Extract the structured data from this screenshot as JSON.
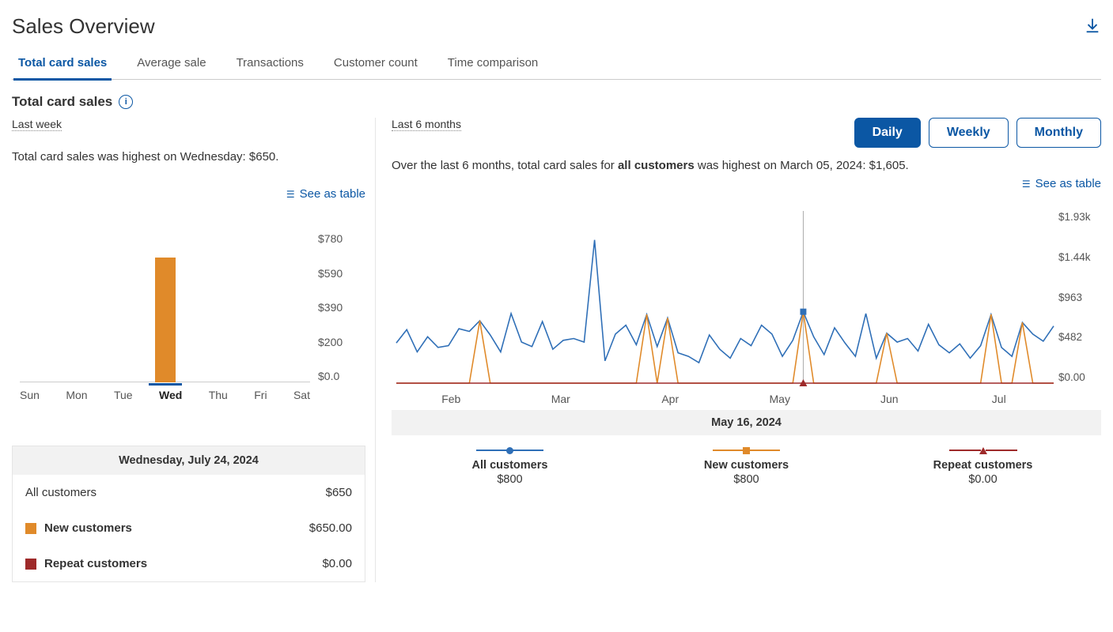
{
  "header": {
    "title": "Sales Overview"
  },
  "tabs": [
    "Total card sales",
    "Average sale",
    "Transactions",
    "Customer count",
    "Time comparison"
  ],
  "active_tab": 0,
  "section_title": "Total card sales",
  "left": {
    "period_label": "Last week",
    "sentence": "Total card sales was highest on Wednesday: $650.",
    "see_table": "See as table",
    "detail": {
      "heading": "Wednesday, July 24, 2024",
      "rows": [
        {
          "label": "All customers",
          "value": "$650"
        },
        {
          "label": "New customers",
          "value": "$650.00"
        },
        {
          "label": "Repeat customers",
          "value": "$0.00"
        }
      ]
    }
  },
  "right": {
    "period_label": "Last 6 months",
    "toggle": {
      "options": [
        "Daily",
        "Weekly",
        "Monthly"
      ],
      "active": 0
    },
    "sentence_prefix": "Over the last 6 months, total card sales for ",
    "sentence_bold": "all customers",
    "sentence_suffix": " was highest on March 05, 2024: $1,605.",
    "see_table": "See as table",
    "hover_date": "May 16, 2024",
    "legend": [
      {
        "name": "All customers",
        "value": "$800",
        "color": "#2f6fb7",
        "shape": "circle"
      },
      {
        "name": "New customers",
        "value": "$800",
        "color": "#e08a2a",
        "shape": "square"
      },
      {
        "name": "Repeat customers",
        "value": "$0.00",
        "color": "#9e2a2a",
        "shape": "triangle"
      }
    ]
  },
  "chart_data": [
    {
      "type": "bar",
      "title": "Total card sales — Last week",
      "categories": [
        "Sun",
        "Mon",
        "Tue",
        "Wed",
        "Thu",
        "Fri",
        "Sat"
      ],
      "values": [
        0,
        0,
        0,
        650,
        0,
        0,
        0
      ],
      "yticks_labels": [
        "$780",
        "$590",
        "$390",
        "$200",
        "$0.0"
      ],
      "ylim": [
        0,
        780
      ],
      "highlight_index": 3
    },
    {
      "type": "line",
      "title": "Total card sales — Last 6 months (Daily)",
      "xticks": [
        "Feb",
        "Mar",
        "Apr",
        "May",
        "Jun",
        "Jul"
      ],
      "yticks_labels": [
        "$1.93k",
        "$1.44k",
        "$963",
        "$482",
        "$0.00"
      ],
      "ylim": [
        0,
        1930
      ],
      "hover_x_label": "May 16, 2024",
      "series": [
        {
          "name": "All customers",
          "color": "#2f6fb7",
          "values": [
            450,
            600,
            350,
            520,
            400,
            420,
            610,
            580,
            700,
            540,
            350,
            780,
            460,
            410,
            690,
            380,
            480,
            500,
            460,
            1605,
            250,
            550,
            650,
            430,
            770,
            410,
            730,
            340,
            300,
            230,
            540,
            380,
            280,
            500,
            420,
            650,
            550,
            300,
            480,
            800,
            520,
            320,
            620,
            450,
            300,
            780,
            280,
            560,
            460,
            500,
            360,
            660,
            430,
            340,
            440,
            280,
            420,
            770,
            400,
            300,
            680,
            550,
            470,
            640
          ]
        },
        {
          "name": "New customers",
          "color": "#e08a2a",
          "values": [
            0,
            0,
            0,
            0,
            0,
            0,
            0,
            0,
            700,
            0,
            0,
            0,
            0,
            0,
            0,
            0,
            0,
            0,
            0,
            0,
            0,
            0,
            0,
            0,
            770,
            0,
            730,
            0,
            0,
            0,
            0,
            0,
            0,
            0,
            0,
            0,
            0,
            0,
            0,
            800,
            0,
            0,
            0,
            0,
            0,
            0,
            0,
            560,
            0,
            0,
            0,
            0,
            0,
            0,
            0,
            0,
            0,
            770,
            0,
            0,
            680,
            0,
            0,
            0
          ]
        },
        {
          "name": "Repeat customers",
          "color": "#9e2a2a",
          "values": [
            0,
            0,
            0,
            0,
            0,
            0,
            0,
            0,
            0,
            0,
            0,
            0,
            0,
            0,
            0,
            0,
            0,
            0,
            0,
            0,
            0,
            0,
            0,
            0,
            0,
            0,
            0,
            0,
            0,
            0,
            0,
            0,
            0,
            0,
            0,
            0,
            0,
            0,
            0,
            0,
            0,
            0,
            0,
            0,
            0,
            0,
            0,
            0,
            0,
            0,
            0,
            0,
            0,
            0,
            0,
            0,
            0,
            0,
            0,
            0,
            0,
            0,
            0,
            0
          ]
        }
      ],
      "hover_index": 39
    }
  ]
}
